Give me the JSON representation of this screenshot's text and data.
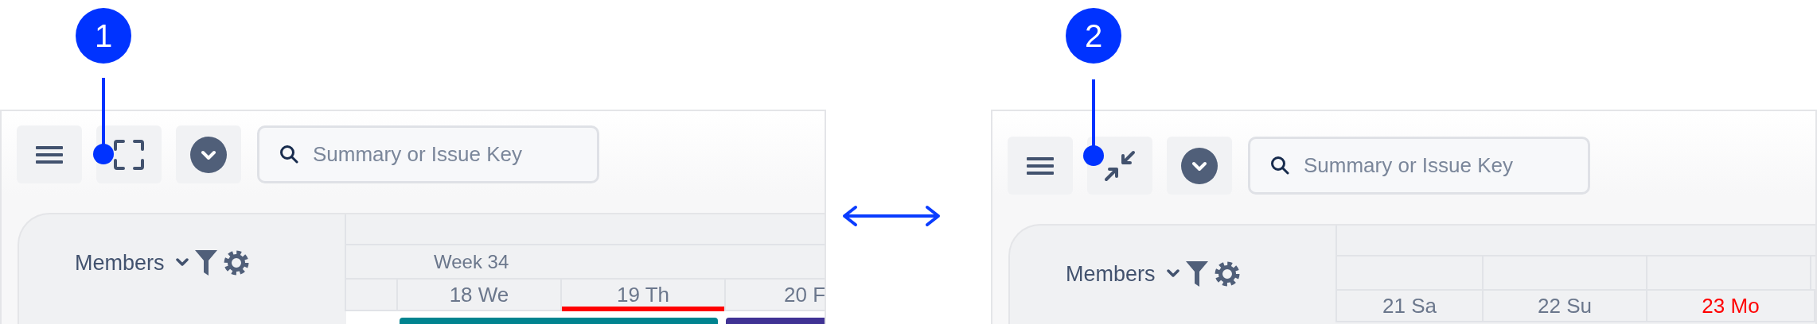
{
  "callouts": [
    {
      "number": "1"
    },
    {
      "number": "2"
    }
  ],
  "panels": [
    {
      "toolbar": [
        {
          "kind": "menu"
        },
        {
          "kind": "expand"
        },
        {
          "kind": "dropdown"
        }
      ],
      "search": {
        "placeholder": "Summary or Issue Key"
      },
      "members": {
        "label": "Members"
      },
      "weeks": [
        {
          "label": "Week 34"
        }
      ],
      "days": [
        {
          "label": "18 We",
          "today": false,
          "highlighted": false
        },
        {
          "label": "19 Th",
          "today": true,
          "highlighted": false
        },
        {
          "label": "20 F",
          "today": false,
          "highlighted": false
        }
      ],
      "events": [
        {
          "color": "#00838f"
        },
        {
          "color": "#403294"
        }
      ]
    },
    {
      "toolbar": [
        {
          "kind": "menu"
        },
        {
          "kind": "collapse"
        },
        {
          "kind": "dropdown"
        }
      ],
      "search": {
        "placeholder": "Summary or Issue Key"
      },
      "members": {
        "label": "Members"
      },
      "days": [
        {
          "label": "21 Sa",
          "today": false,
          "highlighted": false
        },
        {
          "label": "22 Su",
          "today": false,
          "highlighted": false
        },
        {
          "label": "23 Mo",
          "today": false,
          "highlighted": true
        }
      ]
    }
  ]
}
